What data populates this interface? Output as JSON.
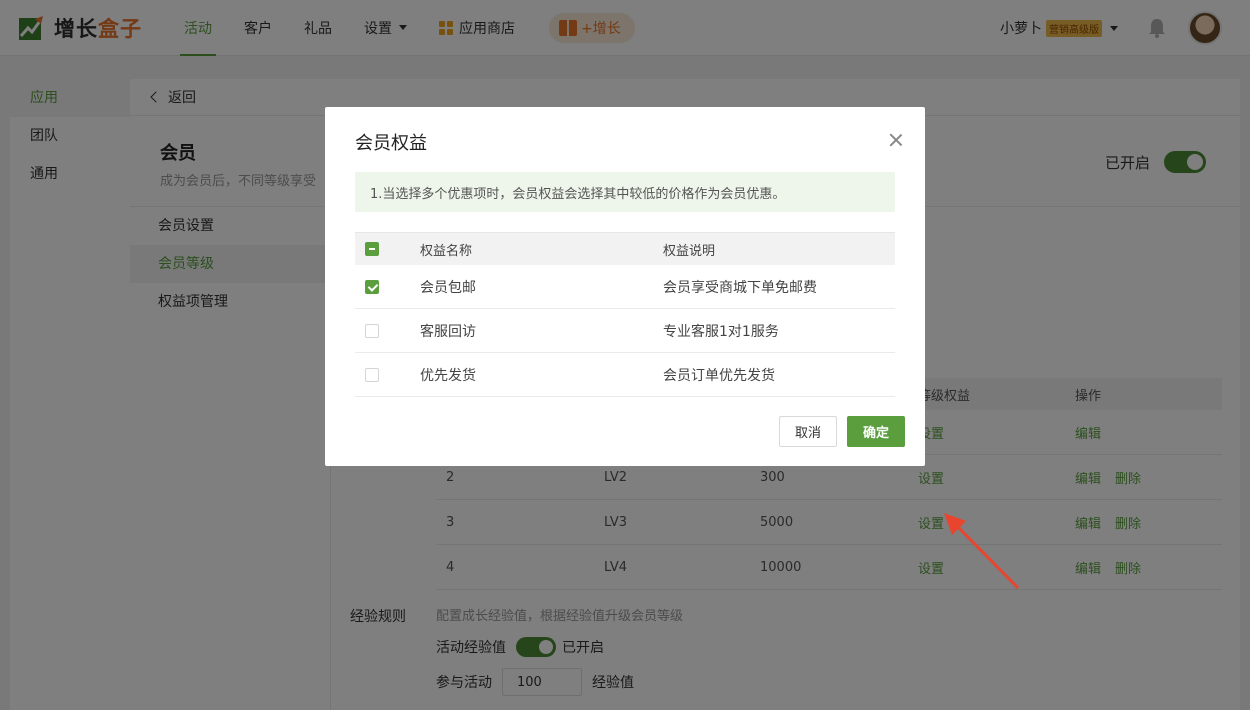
{
  "header": {
    "logo_main": "增长",
    "logo_accent": "盒子",
    "nav": [
      {
        "label": "活动",
        "active": true
      },
      {
        "label": "客户",
        "active": false
      },
      {
        "label": "礼品",
        "active": false
      },
      {
        "label": "设置",
        "active": false,
        "has_dropdown": true
      },
      {
        "label": "应用商店",
        "active": false
      }
    ],
    "boost_label": "+增长",
    "username": "小萝卜",
    "vip_badge": "营销高级版",
    "accent_color": "#5a9e3e",
    "brand_orange": "#e8732a"
  },
  "sidebar": {
    "items": [
      {
        "label": "应用",
        "active": true
      },
      {
        "label": "团队",
        "active": false
      },
      {
        "label": "通用",
        "active": false
      }
    ]
  },
  "main": {
    "back_label": "返回",
    "title": "会员",
    "subtitle": "成为会员后，不同等级享受",
    "status_label": "已开启",
    "subnav": [
      {
        "label": "会员设置",
        "active": false
      },
      {
        "label": "会员等级",
        "active": true
      },
      {
        "label": "权益项管理",
        "active": false
      }
    ],
    "level_table": {
      "headers": [
        "",
        "",
        "",
        "等级权益",
        "操作"
      ],
      "rows": [
        {
          "level": "",
          "name": "",
          "exp": "",
          "benefit_link": "设置",
          "edit": "编辑",
          "delete": ""
        },
        {
          "level": "2",
          "name": "LV2",
          "exp": "300",
          "benefit_link": "设置",
          "edit": "编辑",
          "delete": "删除"
        },
        {
          "level": "3",
          "name": "LV3",
          "exp": "5000",
          "benefit_link": "设置",
          "edit": "编辑",
          "delete": "删除"
        },
        {
          "level": "4",
          "name": "LV4",
          "exp": "10000",
          "benefit_link": "设置",
          "edit": "编辑",
          "delete": "删除"
        }
      ]
    },
    "exp_rules": {
      "label": "经验规则",
      "desc": "配置成长经验值，根据经验值升级会员等级",
      "activity_label": "活动经验值",
      "activity_status": "已开启",
      "participate_label": "参与活动",
      "participate_value": "100",
      "unit_label": "经验值"
    }
  },
  "modal": {
    "title": "会员权益",
    "notice": "1.当选择多个优惠项时，会员权益会选择其中较低的价格作为会员优惠。",
    "headers": {
      "name": "权益名称",
      "desc": "权益说明"
    },
    "rows": [
      {
        "name": "会员包邮",
        "desc": "会员享受商城下单免邮费",
        "checked": true
      },
      {
        "name": "客服回访",
        "desc": "专业客服1对1服务",
        "checked": false
      },
      {
        "name": "优先发货",
        "desc": "会员订单优先发货",
        "checked": false
      }
    ],
    "cancel_label": "取消",
    "ok_label": "确定"
  },
  "annotation": {
    "arrow_color": "#e8442e"
  }
}
